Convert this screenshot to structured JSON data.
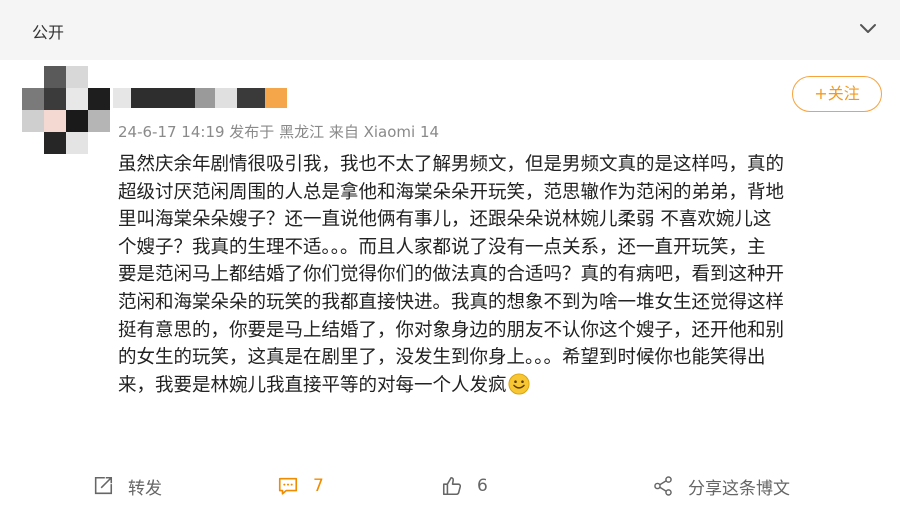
{
  "header": {
    "visibility_label": "公开"
  },
  "post": {
    "follow_label": "+关注",
    "meta": "24-6-17 14:19 发布于 黑龙江 来自 Xiaomi 14",
    "content_lines": [
      "虽然庆余年剧情很吸引我，我也不太了解男频文，但是男频文真的是这样吗，真的",
      "超级讨厌范闲周围的人总是拿他和海棠朵朵开玩笑，范思辙作为范闲的弟弟，背地",
      "里叫海棠朵朵嫂子？还一直说他俩有事儿，还跟朵朵说林婉儿柔弱 不喜欢婉儿这",
      "个嫂子？我真的生理不适。。。而且人家都说了没有一点关系，还一直开玩笑，主",
      "要是范闲马上都结婚了你们觉得你们的做法真的合适吗？真的有病吧，看到这种开",
      "范闲和海棠朵朵的玩笑的我都直接快进。我真的想象不到为啥一堆女生还觉得这样",
      "挺有意思的，你要是马上结婚了，你对象身边的朋友不认你这个嫂子，还开他和别",
      "的女生的玩笑，这真是在剧里了，没发生到你身上。。。希望到时候你也能笑得出",
      "来，我要是林婉儿我直接平等的对每一个人发疯"
    ],
    "emoji_icon": "smile-emoji"
  },
  "actions": {
    "repost_label": "转发",
    "comment_count": "7",
    "like_count": "6",
    "share_label": "分享这条博文"
  },
  "colors": {
    "accent": "#f29a1f",
    "topbar_bg": "#f5f5f5",
    "meta_text": "#8a8a8a"
  }
}
